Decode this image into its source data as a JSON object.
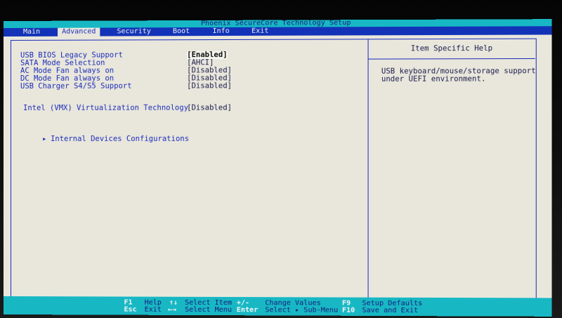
{
  "title": "Phoenix SecureCore Technology Setup",
  "menu": [
    {
      "label": "Main",
      "active": false
    },
    {
      "label": "Advanced",
      "active": true
    },
    {
      "label": "Security",
      "active": false
    },
    {
      "label": "Boot",
      "active": false
    },
    {
      "label": "Info",
      "active": false
    },
    {
      "label": "Exit",
      "active": false
    }
  ],
  "settings": [
    {
      "label": "USB BIOS Legacy Support",
      "value": "[Enabled]"
    },
    {
      "label": "SATA Mode Selection",
      "value": "[AHCI]"
    },
    {
      "label": "AC Mode Fan always on",
      "value": "[Disabled]"
    },
    {
      "label": "DC Mode Fan always on",
      "value": "[Disabled]"
    },
    {
      "label": "USB Charger S4/S5 Support",
      "value": "[Disabled]"
    },
    {
      "label": "Intel (VMX) Virtualization Technology",
      "value": "[Disabled]"
    }
  ],
  "submenu": {
    "label": "Internal Devices Configurations",
    "icon": "right-triangle-icon"
  },
  "help": {
    "title": "Item Specific Help",
    "lines": [
      "USB keyboard/mouse/storage support",
      "under UEFI environment."
    ]
  },
  "footer": {
    "f1_key": "F1",
    "f1_desc": "Help",
    "updown_key": "↑↓",
    "updown_desc": "Select Item",
    "plusminus_key": "+/-",
    "plusminus_desc": "Change Values",
    "f9_key": "F9",
    "f9_desc": "Setup Defaults",
    "esc_key": "Esc",
    "esc_desc": "Exit",
    "leftright_key": "←→",
    "leftright_desc": "Select Menu",
    "enter_key": "Enter",
    "enter_desc": "Select ▸ Sub-Menu",
    "f10_key": "F10",
    "f10_desc": "Save and Exit"
  },
  "colors": {
    "screen_bg": "#e9e7dc",
    "title_bar": "#17b8c4",
    "menu_bar": "#1233b8",
    "text_blue": "#1a2bb8",
    "highlight_white": "#f5f5f5"
  }
}
